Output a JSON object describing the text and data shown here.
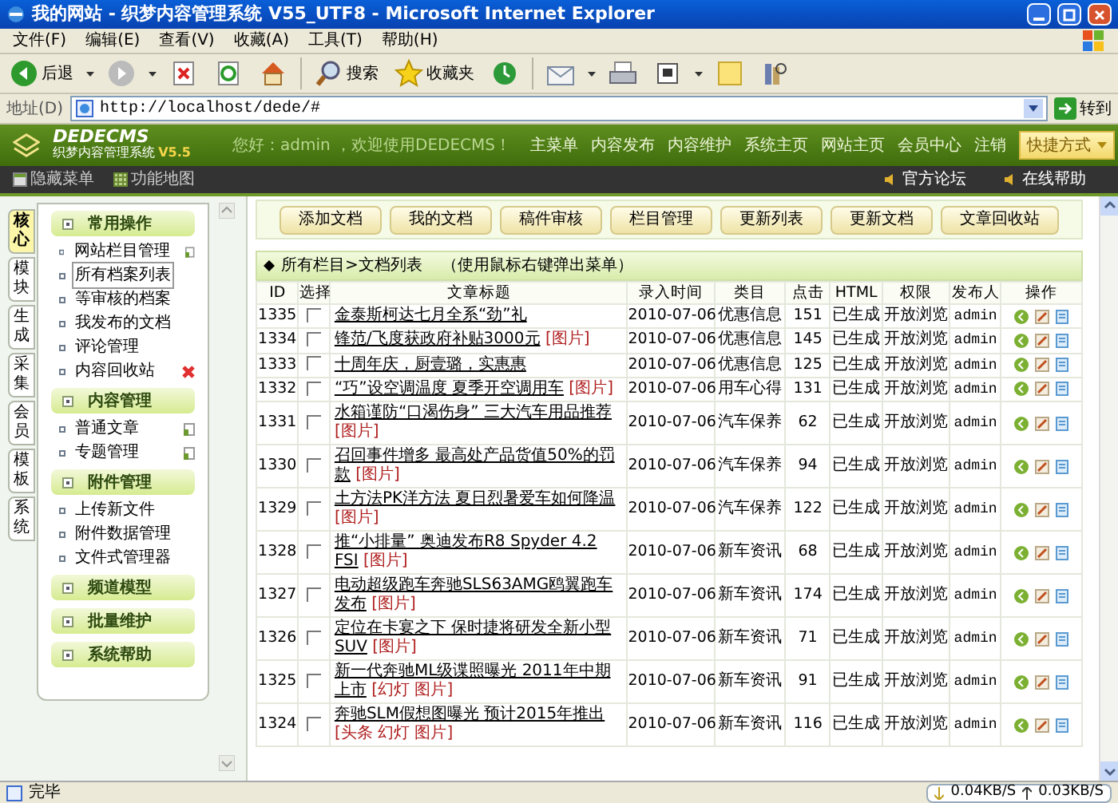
{
  "window": {
    "title": "我的网站 - 织梦内容管理系统 V55_UTF8 - Microsoft Internet Explorer"
  },
  "menu": [
    "文件(F)",
    "编辑(E)",
    "查看(V)",
    "收藏(A)",
    "工具(T)",
    "帮助(H)"
  ],
  "toolbar": [
    {
      "kind": "back",
      "label": "后退"
    },
    {
      "kind": "forward"
    },
    {
      "kind": "stop"
    },
    {
      "kind": "refresh"
    },
    {
      "kind": "home"
    },
    {
      "kind": "search",
      "label": "搜索"
    },
    {
      "kind": "favorites",
      "label": "收藏夹"
    },
    {
      "kind": "history"
    },
    {
      "kind": "mail"
    },
    {
      "kind": "print"
    },
    {
      "kind": "edit"
    },
    {
      "kind": "note"
    },
    {
      "kind": "research"
    }
  ],
  "address": {
    "label": "地址(D)",
    "value": "http://localhost/dede/#",
    "go": "转到"
  },
  "header": {
    "logo": "DEDECMS",
    "subtitle": "织梦内容管理系统",
    "version": "V5.5",
    "greeting": "您好：admin ，欢迎使用DEDECMS！",
    "nav": [
      "主菜单",
      "内容发布",
      "内容维护",
      "系统主页",
      "网站主页",
      "会员中心",
      "注销"
    ],
    "quick": "快捷方式"
  },
  "subbar": {
    "left": [
      "隐藏菜单",
      "功能地图"
    ],
    "right": [
      "官方论坛",
      "在线帮助"
    ]
  },
  "side_tabs": [
    {
      "label": "核心",
      "selected": true
    },
    {
      "label": "模块",
      "selected": false
    },
    {
      "label": "生成",
      "selected": false
    },
    {
      "label": "采集",
      "selected": false
    },
    {
      "label": "会员",
      "selected": false
    },
    {
      "label": "模板",
      "selected": false
    },
    {
      "label": "系统",
      "selected": false
    }
  ],
  "sidebar": [
    {
      "title": "常用操作",
      "items": [
        {
          "label": "网站栏目管理",
          "selected": false,
          "kind": "doc"
        },
        {
          "label": "所有档案列表",
          "selected": true
        },
        {
          "label": "等审核的档案",
          "selected": false
        },
        {
          "label": "我发布的文档",
          "selected": false
        },
        {
          "label": "评论管理",
          "selected": false
        },
        {
          "label": "内容回收站",
          "selected": false,
          "kind": "delete"
        }
      ]
    },
    {
      "title": "内容管理",
      "items": [
        {
          "label": "普通文章",
          "selected": false,
          "kind": "doc"
        },
        {
          "label": "专题管理",
          "selected": false,
          "kind": "doc"
        }
      ]
    },
    {
      "title": "附件管理",
      "items": [
        {
          "label": "上传新文件",
          "selected": false
        },
        {
          "label": "附件数据管理",
          "selected": false
        },
        {
          "label": "文件式管理器",
          "selected": false
        }
      ]
    },
    {
      "title": "频道模型"
    },
    {
      "title": "批量维护"
    },
    {
      "title": "系统帮助"
    }
  ],
  "actions": [
    "添加文档",
    "我的文档",
    "稿件审核",
    "栏目管理",
    "更新列表",
    "更新文档",
    "文章回收站"
  ],
  "list_heading": {
    "path": "所有栏目>文档列表",
    "hint": "（使用鼠标右键弹出菜单）"
  },
  "table": {
    "columns": [
      "ID",
      "选择",
      "文章标题",
      "录入时间",
      "类目",
      "点击",
      "HTML",
      "权限",
      "发布人",
      "操作"
    ],
    "rows": [
      {
        "id": "1335",
        "checked": false,
        "title": "金泰斯柯达七月全系“劲”礼",
        "tags": "",
        "date": "2010-07-06",
        "category": "优惠信息",
        "clicks": "151",
        "html": "已生成",
        "access": "开放浏览",
        "author": "admin"
      },
      {
        "id": "1334",
        "checked": false,
        "title": "锋范/飞度获政府补贴3000元",
        "tags": "[图片]",
        "date": "2010-07-06",
        "category": "优惠信息",
        "clicks": "145",
        "html": "已生成",
        "access": "开放浏览",
        "author": "admin"
      },
      {
        "id": "1333",
        "checked": false,
        "title": "十周年庆，厨壹璐，实惠惠",
        "tags": "",
        "date": "2010-07-06",
        "category": "优惠信息",
        "clicks": "125",
        "html": "已生成",
        "access": "开放浏览",
        "author": "admin"
      },
      {
        "id": "1332",
        "checked": false,
        "title": "“巧”设空调温度 夏季开空调用车",
        "tags": "[图片]",
        "date": "2010-07-06",
        "category": "用车心得",
        "clicks": "131",
        "html": "已生成",
        "access": "开放浏览",
        "author": "admin"
      },
      {
        "id": "1331",
        "checked": false,
        "title": "水箱谨防“口渴伤身” 三大汽车用品推荐",
        "tags": "[图片]",
        "date": "2010-07-06",
        "category": "汽车保养",
        "clicks": "62",
        "html": "已生成",
        "access": "开放浏览",
        "author": "admin"
      },
      {
        "id": "1330",
        "checked": false,
        "title": "召回事件增多 最高处产品货值50%的罚款",
        "tags": "[图片]",
        "date": "2010-07-06",
        "category": "汽车保养",
        "clicks": "94",
        "html": "已生成",
        "access": "开放浏览",
        "author": "admin"
      },
      {
        "id": "1329",
        "checked": false,
        "title": "土方法PK洋方法 夏日烈暑爱车如何降温",
        "tags": "[图片]",
        "date": "2010-07-06",
        "category": "汽车保养",
        "clicks": "122",
        "html": "已生成",
        "access": "开放浏览",
        "author": "admin"
      },
      {
        "id": "1328",
        "checked": false,
        "title": "推“小排量” 奥迪发布R8 Spyder 4.2 FSI",
        "tags": "[图片]",
        "date": "2010-07-06",
        "category": "新车资讯",
        "clicks": "68",
        "html": "已生成",
        "access": "开放浏览",
        "author": "admin"
      },
      {
        "id": "1327",
        "checked": false,
        "title": "电动超级跑车奔驰SLS63AMG鸥翼跑车发布",
        "tags": "[图片]",
        "date": "2010-07-06",
        "category": "新车资讯",
        "clicks": "174",
        "html": "已生成",
        "access": "开放浏览",
        "author": "admin"
      },
      {
        "id": "1326",
        "checked": false,
        "title": "定位在卡宴之下 保时捷将研发全新小型SUV",
        "tags": "[图片]",
        "date": "2010-07-06",
        "category": "新车资讯",
        "clicks": "71",
        "html": "已生成",
        "access": "开放浏览",
        "author": "admin"
      },
      {
        "id": "1325",
        "checked": false,
        "title": "新一代奔驰ML级谍照曝光 2011年中期上市",
        "tags": "[幻灯 图片]",
        "date": "2010-07-06",
        "category": "新车资讯",
        "clicks": "91",
        "html": "已生成",
        "access": "开放浏览",
        "author": "admin"
      },
      {
        "id": "1324",
        "checked": false,
        "title": "奔驰SLM假想图曝光 预计2015年推出",
        "tags": "[头条 幻灯 图片]",
        "date": "2010-07-06",
        "category": "新车资讯",
        "clicks": "116",
        "html": "已生成",
        "access": "开放浏览",
        "author": "admin"
      }
    ]
  },
  "status_bar": {
    "text": "完毕",
    "download": "0.04KB/S",
    "upload": "0.03KB/S"
  }
}
